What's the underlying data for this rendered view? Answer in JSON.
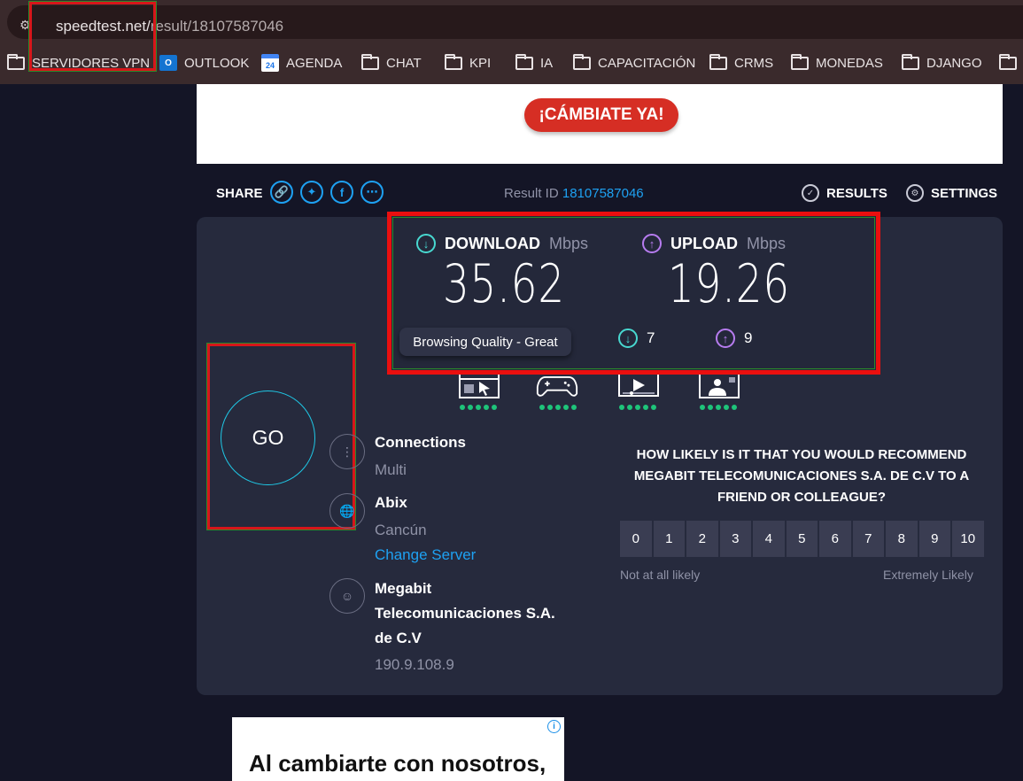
{
  "browser": {
    "url_host": "speedtest.net/",
    "url_path": "result/18107587046",
    "bookmarks": [
      {
        "label": "SERVIDORES VPN",
        "icon": "folder-icon"
      },
      {
        "label": "OUTLOOK",
        "icon": "outlook-icon"
      },
      {
        "label": "AGENDA",
        "icon": "calendar-icon"
      },
      {
        "label": "CHAT",
        "icon": "folder-icon"
      },
      {
        "label": "KPI",
        "icon": "folder-icon"
      },
      {
        "label": "IA",
        "icon": "folder-icon"
      },
      {
        "label": "CAPACITACIÓN",
        "icon": "folder-icon"
      },
      {
        "label": "CRMS",
        "icon": "folder-icon"
      },
      {
        "label": "MONEDAS",
        "icon": "folder-icon"
      },
      {
        "label": "DJANGO",
        "icon": "folder-icon"
      }
    ]
  },
  "banner": {
    "cta_label": "¡CÁMBIATE YA!",
    "cta_color": "#d62e24"
  },
  "toolbar": {
    "share_label": "SHARE",
    "result_id_label": "Result ID",
    "result_id_value": "18107587046",
    "results_label": "RESULTS",
    "settings_label": "SETTINGS"
  },
  "result": {
    "download_label": "DOWNLOAD",
    "upload_label": "UPLOAD",
    "unit": "Mbps",
    "download_value": "35.62",
    "upload_value": "19.26",
    "tooltip": "Browsing Quality - Great",
    "ping_down": "7",
    "ping_up": "9",
    "download_color": "#48d8d0",
    "upload_color": "#b77cf0"
  },
  "quality": {
    "icons": [
      "browsing-icon",
      "gaming-icon",
      "streaming-icon",
      "video-call-icon"
    ],
    "rating_dots": 5,
    "dot_color": "#1ec47a"
  },
  "go_label": "GO",
  "server": {
    "connections_title": "Connections",
    "connections_value": "Multi",
    "server_name": "Abix",
    "server_location": "Cancún",
    "change_server": "Change Server",
    "isp_line1": "Megabit",
    "isp_line2": "Telecomunicaciones S.A.",
    "isp_line3": "de C.V",
    "ip": "190.9.108.9"
  },
  "nps": {
    "question": "HOW LIKELY IS IT THAT YOU WOULD RECOMMEND MEGABIT TELECOMUNICACIONES S.A. DE C.V TO A FRIEND OR COLLEAGUE?",
    "scale": [
      "0",
      "1",
      "2",
      "3",
      "4",
      "5",
      "6",
      "7",
      "8",
      "9",
      "10"
    ],
    "low_label": "Not at all likely",
    "high_label": "Extremely Likely"
  },
  "ad": {
    "text": "Al cambiarte con nosotros,"
  }
}
